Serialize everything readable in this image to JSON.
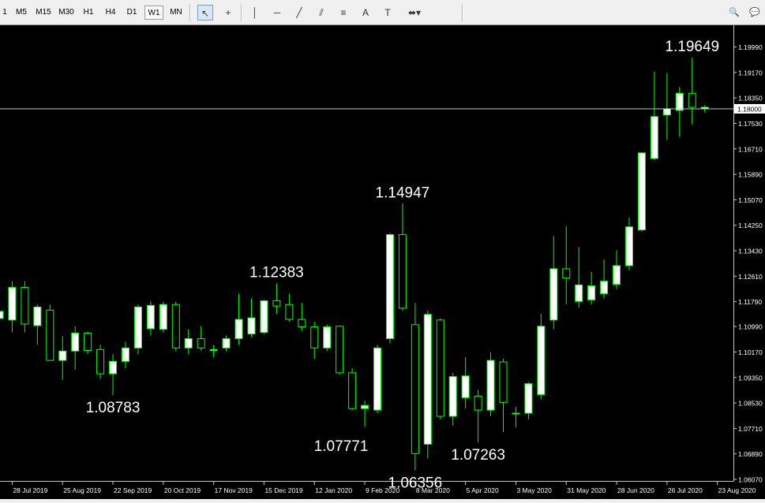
{
  "toolbar": {
    "timeframes": [
      "1",
      "M5",
      "M15",
      "M30",
      "H1",
      "H4",
      "D1",
      "W1",
      "MN"
    ],
    "active_timeframe": "W1",
    "tools": [
      {
        "name": "cursor-icon",
        "glyph": "↖"
      },
      {
        "name": "crosshair-icon",
        "glyph": "+"
      },
      {
        "name": "vertical-line-icon",
        "glyph": "│"
      },
      {
        "name": "horizontal-line-icon",
        "glyph": "─"
      },
      {
        "name": "trendline-icon",
        "glyph": "╱"
      },
      {
        "name": "equidistant-channel-icon",
        "glyph": "⫽"
      },
      {
        "name": "fibonacci-icon",
        "glyph": "≡"
      },
      {
        "name": "text-icon",
        "glyph": "A"
      },
      {
        "name": "text-label-icon",
        "glyph": "T"
      },
      {
        "name": "shapes-dropdown-icon",
        "glyph": "⬌▾"
      }
    ],
    "right_icons": [
      {
        "name": "search-icon",
        "glyph": "🔍"
      },
      {
        "name": "chat-icon",
        "glyph": "💬"
      }
    ]
  },
  "chart_data": {
    "type": "candlestick",
    "colors": {
      "background": "#000000",
      "bull_body": "#ffffff",
      "bear_body": "#000000",
      "wick": "#00ff00",
      "bid_line": "#c0c0c0",
      "text": "#ffffff"
    },
    "ylim": [
      1.0607,
      1.2031
    ],
    "y_ticks": [
      "1.19990",
      "1.19170",
      "1.18350",
      "1.17530",
      "1.16710",
      "1.15890",
      "1.15070",
      "1.14250",
      "1.13430",
      "1.12610",
      "1.11790",
      "1.10990",
      "1.10170",
      "1.09350",
      "1.08530",
      "1.07710",
      "1.06890",
      "1.06070"
    ],
    "current_price": "1.18000",
    "x_ticks": [
      {
        "label": "28 Jul 2019",
        "i": 1
      },
      {
        "label": "25 Aug 2019",
        "i": 5
      },
      {
        "label": "22 Sep 2019",
        "i": 9
      },
      {
        "label": "20 Oct 2019",
        "i": 13
      },
      {
        "label": "17 Nov 2019",
        "i": 17
      },
      {
        "label": "15 Dec 2019",
        "i": 21
      },
      {
        "label": "12 Jan 2020",
        "i": 25
      },
      {
        "label": "9 Feb 2020",
        "i": 29
      },
      {
        "label": "8 Mar 2020",
        "i": 33
      },
      {
        "label": "5 Apr 2020",
        "i": 37
      },
      {
        "label": "3 May 2020",
        "i": 41
      },
      {
        "label": "31 May 2020",
        "i": 45
      },
      {
        "label": "28 Jun 2020",
        "i": 49
      },
      {
        "label": "26 Jul 2020",
        "i": 53
      },
      {
        "label": "23 Aug 2020",
        "i": 57
      }
    ],
    "candles": [
      {
        "o": 1.1125,
        "h": 1.1168,
        "l": 1.104,
        "c": 1.1148
      },
      {
        "o": 1.112,
        "h": 1.1245,
        "l": 1.108,
        "c": 1.1225
      },
      {
        "o": 1.1225,
        "h": 1.1245,
        "l": 1.108,
        "c": 1.1107
      },
      {
        "o": 1.1102,
        "h": 1.117,
        "l": 1.104,
        "c": 1.1162
      },
      {
        "o": 1.1152,
        "h": 1.117,
        "l": 1.101,
        "c": 1.099
      },
      {
        "o": 1.099,
        "h": 1.1068,
        "l": 1.0927,
        "c": 1.102
      },
      {
        "o": 1.102,
        "h": 1.11,
        "l": 1.096,
        "c": 1.1078
      },
      {
        "o": 1.1078,
        "h": 1.1082,
        "l": 1.101,
        "c": 1.1022
      },
      {
        "o": 1.1025,
        "h": 1.104,
        "l": 1.093,
        "c": 1.0947
      },
      {
        "o": 1.0947,
        "h": 1.101,
        "l": 1.0878,
        "c": 1.0987
      },
      {
        "o": 1.0987,
        "h": 1.105,
        "l": 1.0965,
        "c": 1.103
      },
      {
        "o": 1.103,
        "h": 1.117,
        "l": 1.101,
        "c": 1.1162
      },
      {
        "o": 1.1092,
        "h": 1.118,
        "l": 1.107,
        "c": 1.1167
      },
      {
        "o": 1.109,
        "h": 1.1178,
        "l": 1.108,
        "c": 1.117
      },
      {
        "o": 1.117,
        "h": 1.1178,
        "l": 1.102,
        "c": 1.103
      },
      {
        "o": 1.103,
        "h": 1.109,
        "l": 1.101,
        "c": 1.106
      },
      {
        "o": 1.106,
        "h": 1.11,
        "l": 1.1022,
        "c": 1.103
      },
      {
        "o": 1.1022,
        "h": 1.104,
        "l": 1.1,
        "c": 1.1025
      },
      {
        "o": 1.103,
        "h": 1.107,
        "l": 1.102,
        "c": 1.106
      },
      {
        "o": 1.106,
        "h": 1.1205,
        "l": 1.104,
        "c": 1.1122
      },
      {
        "o": 1.1075,
        "h": 1.119,
        "l": 1.1065,
        "c": 1.1127
      },
      {
        "o": 1.108,
        "h": 1.1185,
        "l": 1.1075,
        "c": 1.1182
      },
      {
        "o": 1.1182,
        "h": 1.1238,
        "l": 1.114,
        "c": 1.1165
      },
      {
        "o": 1.117,
        "h": 1.1205,
        "l": 1.1115,
        "c": 1.1122
      },
      {
        "o": 1.1122,
        "h": 1.1175,
        "l": 1.1085,
        "c": 1.1098
      },
      {
        "o": 1.1098,
        "h": 1.1115,
        "l": 1.0995,
        "c": 1.103
      },
      {
        "o": 1.103,
        "h": 1.1105,
        "l": 1.102,
        "c": 1.1098
      },
      {
        "o": 1.11,
        "h": 1.1102,
        "l": 1.0945,
        "c": 1.095
      },
      {
        "o": 1.095,
        "h": 1.0965,
        "l": 1.083,
        "c": 1.0835
      },
      {
        "o": 1.0835,
        "h": 1.086,
        "l": 1.0777,
        "c": 1.0845
      },
      {
        "o": 1.083,
        "h": 1.104,
        "l": 1.082,
        "c": 1.103
      },
      {
        "o": 1.106,
        "h": 1.14,
        "l": 1.1045,
        "c": 1.1395
      },
      {
        "o": 1.1395,
        "h": 1.1495,
        "l": 1.115,
        "c": 1.1158
      },
      {
        "o": 1.1105,
        "h": 1.1175,
        "l": 1.0636,
        "c": 1.069
      },
      {
        "o": 1.072,
        "h": 1.115,
        "l": 1.0675,
        "c": 1.1138
      },
      {
        "o": 1.112,
        "h": 1.1125,
        "l": 1.08,
        "c": 1.081
      },
      {
        "o": 1.081,
        "h": 1.095,
        "l": 1.078,
        "c": 1.0938
      },
      {
        "o": 1.087,
        "h": 1.1,
        "l": 1.0835,
        "c": 1.094
      },
      {
        "o": 1.0875,
        "h": 1.0895,
        "l": 1.0726,
        "c": 1.083
      },
      {
        "o": 1.083,
        "h": 1.1015,
        "l": 1.081,
        "c": 1.099
      },
      {
        "o": 1.0985,
        "h": 1.0995,
        "l": 1.076,
        "c": 1.0855
      },
      {
        "o": 1.082,
        "h": 1.084,
        "l": 1.0775,
        "c": 1.082
      },
      {
        "o": 1.082,
        "h": 1.092,
        "l": 1.08,
        "c": 1.0915
      },
      {
        "o": 1.088,
        "h": 1.114,
        "l": 1.0865,
        "c": 1.11
      },
      {
        "o": 1.112,
        "h": 1.139,
        "l": 1.109,
        "c": 1.1285
      },
      {
        "o": 1.1285,
        "h": 1.1422,
        "l": 1.117,
        "c": 1.1255
      },
      {
        "o": 1.118,
        "h": 1.1355,
        "l": 1.116,
        "c": 1.1233
      },
      {
        "o": 1.1185,
        "h": 1.1275,
        "l": 1.117,
        "c": 1.123
      },
      {
        "o": 1.1205,
        "h": 1.1315,
        "l": 1.119,
        "c": 1.1245
      },
      {
        "o": 1.1235,
        "h": 1.1345,
        "l": 1.122,
        "c": 1.1295
      },
      {
        "o": 1.1295,
        "h": 1.145,
        "l": 1.128,
        "c": 1.142
      },
      {
        "o": 1.141,
        "h": 1.166,
        "l": 1.1405,
        "c": 1.1658
      },
      {
        "o": 1.164,
        "h": 1.192,
        "l": 1.1635,
        "c": 1.1775
      },
      {
        "o": 1.178,
        "h": 1.1915,
        "l": 1.17,
        "c": 1.18
      },
      {
        "o": 1.1795,
        "h": 1.187,
        "l": 1.171,
        "c": 1.185
      },
      {
        "o": 1.185,
        "h": 1.1965,
        "l": 1.175,
        "c": 1.1805
      },
      {
        "o": 1.18,
        "h": 1.1812,
        "l": 1.1788,
        "c": 1.1805
      }
    ],
    "annotations": [
      {
        "text": "1.19649",
        "i": 55,
        "price": 1.19649,
        "pos": "above"
      },
      {
        "text": "1.14947",
        "i": 32,
        "price": 1.14947,
        "pos": "above"
      },
      {
        "text": "1.12383",
        "i": 22,
        "price": 1.12383,
        "pos": "above"
      },
      {
        "text": "1.08783",
        "i": 9,
        "price": 1.08783,
        "pos": "below"
      },
      {
        "text": "1.07771",
        "i": 29,
        "price": 1.07771,
        "pos": "below-left"
      },
      {
        "text": "1.06356",
        "i": 33,
        "price": 1.06356,
        "pos": "below"
      },
      {
        "text": "1.07263",
        "i": 38,
        "price": 1.07263,
        "pos": "below"
      }
    ]
  }
}
